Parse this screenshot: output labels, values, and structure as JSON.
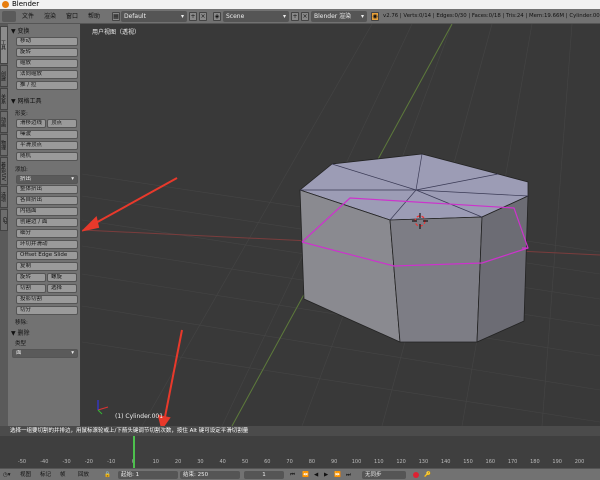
{
  "app": {
    "title": "Blender"
  },
  "menu": {
    "items": [
      "文件",
      "渲染",
      "窗口",
      "帮助"
    ],
    "layout": "Default",
    "scene": "Scene",
    "engine": "Blender 渲染",
    "stats": "v2.76 | Verts:0/14 | Edges:0/30 | Faces:0/18 | Tris:24 | Mem:19.66M | Cylinder.001"
  },
  "tabs": [
    "工具",
    "创建",
    "关系",
    "动画",
    "物理",
    "着色/UV",
    "选项",
    "GP"
  ],
  "shelf": {
    "transform_header": "▼ 变换",
    "transform_buttons": [
      "移动",
      "旋转",
      "缩放",
      "法向缩放",
      "推 / 拉"
    ],
    "mesh_tools_header": "▼ 网格工具",
    "deform_label": "形变:",
    "deform_buttons": [
      "滑移边线",
      "顶点"
    ],
    "deform_more": [
      "噪波",
      "平滑顶点",
      "随机"
    ],
    "add_label": "添加:",
    "extrude_dropdown": "挤出",
    "add_buttons": [
      "整体挤出",
      "各自挤出",
      "内插面",
      "创建边 / 面",
      "细分",
      "环切并滑动",
      "Offset Edge Slide",
      "复制"
    ],
    "spin_buttons": [
      "旋转",
      "螺旋"
    ],
    "knife_buttons": [
      "切割",
      "选择"
    ],
    "more_buttons": [
      "投影切割",
      "切分"
    ],
    "remove_label": "移除:",
    "delete_header": "▼ 删除",
    "type_label": "类型",
    "type_value": "面"
  },
  "viewport": {
    "title": "用户视图（透视）",
    "object_label": "(1) Cylinder.001"
  },
  "hint": "选择一组要切割的并排边，用鼠标滚轮或上/下箭头键调节切割次数，按住 Alt 键可设定平滑切割量",
  "timeline": {
    "ticks": [
      "-50",
      "-40",
      "-30",
      "-20",
      "-10",
      "0",
      "10",
      "20",
      "30",
      "40",
      "50",
      "60",
      "70",
      "80",
      "90",
      "100",
      "110",
      "120",
      "130",
      "140",
      "150",
      "160",
      "170",
      "180",
      "190",
      "200"
    ],
    "current_frame": 1
  },
  "bottombar": {
    "menus": [
      "视图",
      "标记",
      "帧",
      "回放"
    ],
    "start_label": "起始:",
    "start_value": "1",
    "end_label": "结束:",
    "end_value": "250",
    "current_value": "1",
    "sync": "无同步"
  },
  "colors": {
    "accent": "#e87d0d",
    "selection": "#cc33cc",
    "annotation": "#e8392b"
  }
}
